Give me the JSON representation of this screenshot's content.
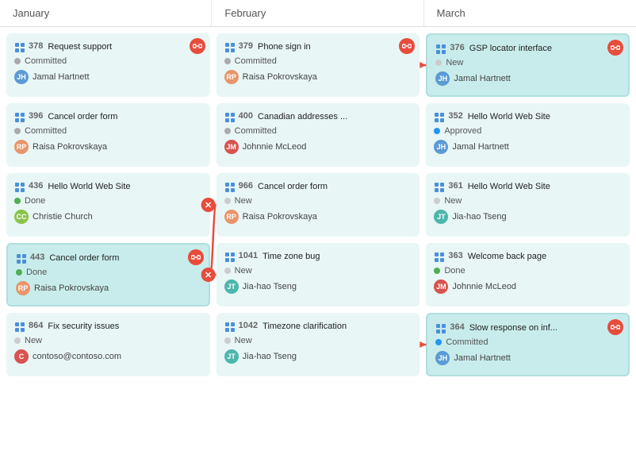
{
  "columns": [
    {
      "label": "January",
      "cards": [
        {
          "id": "378",
          "name": "Request support",
          "status": "Committed",
          "statusType": "committed",
          "user": "Jamal Hartnett",
          "avatarType": "blue",
          "avatarText": "JH",
          "hasLink": true,
          "highlighted": false
        },
        {
          "id": "396",
          "name": "Cancel order form",
          "status": "Committed",
          "statusType": "committed",
          "user": "Raisa Pokrovskaya",
          "avatarType": "orange",
          "avatarText": "RP",
          "hasLink": false,
          "highlighted": false
        },
        {
          "id": "436",
          "name": "Hello World Web Site",
          "status": "Done",
          "statusType": "done",
          "user": "Christie Church",
          "avatarType": "green",
          "avatarText": "CC",
          "hasLink": false,
          "highlighted": false
        },
        {
          "id": "443",
          "name": "Cancel order form",
          "status": "Done",
          "statusType": "done",
          "user": "Raisa Pokrovskaya",
          "avatarType": "orange",
          "avatarText": "RP",
          "hasLink": true,
          "highlighted": true
        },
        {
          "id": "864",
          "name": "Fix security issues",
          "status": "New",
          "statusType": "new",
          "user": "contoso@contoso.com",
          "avatarType": "pink",
          "avatarText": "C",
          "hasLink": false,
          "highlighted": false
        }
      ]
    },
    {
      "label": "February",
      "cards": [
        {
          "id": "379",
          "name": "Phone sign in",
          "status": "Committed",
          "statusType": "committed",
          "user": "Raisa Pokrovskaya",
          "avatarType": "orange",
          "avatarText": "RP",
          "hasLink": true,
          "highlighted": false
        },
        {
          "id": "400",
          "name": "Canadian addresses ...",
          "status": "Committed",
          "statusType": "committed",
          "user": "Johnnie McLeod",
          "avatarType": "pink",
          "avatarText": "JM",
          "hasLink": false,
          "highlighted": false
        },
        {
          "id": "966",
          "name": "Cancel order form",
          "status": "New",
          "statusType": "new",
          "user": "Raisa Pokrovskaya",
          "avatarType": "orange",
          "avatarText": "RP",
          "hasLink": false,
          "highlighted": false
        },
        {
          "id": "1041",
          "name": "Time zone bug",
          "status": "New",
          "statusType": "new",
          "user": "Jia-hao Tseng",
          "avatarType": "teal",
          "avatarText": "JT",
          "hasLink": false,
          "highlighted": false
        },
        {
          "id": "1042",
          "name": "Timezone clarification",
          "status": "New",
          "statusType": "new",
          "user": "Jia-hao Tseng",
          "avatarType": "teal",
          "avatarText": "JT",
          "hasLink": false,
          "highlighted": false
        }
      ]
    },
    {
      "label": "March",
      "cards": [
        {
          "id": "376",
          "name": "GSP locator interface",
          "status": "New",
          "statusType": "new",
          "user": "Jamal Hartnett",
          "avatarType": "blue",
          "avatarText": "JH",
          "hasLink": true,
          "highlighted": true
        },
        {
          "id": "352",
          "name": "Hello World Web Site",
          "status": "Approved",
          "statusType": "approved",
          "user": "Jamal Hartnett",
          "avatarType": "blue",
          "avatarText": "JH",
          "hasLink": false,
          "highlighted": false
        },
        {
          "id": "361",
          "name": "Hello World Web Site",
          "status": "New",
          "statusType": "new",
          "user": "Jia-hao Tseng",
          "avatarType": "teal",
          "avatarText": "JT",
          "hasLink": false,
          "highlighted": false
        },
        {
          "id": "363",
          "name": "Welcome back page",
          "status": "Done",
          "statusType": "done",
          "user": "Johnnie McLeod",
          "avatarType": "pink",
          "avatarText": "JM",
          "hasLink": false,
          "highlighted": false
        },
        {
          "id": "364",
          "name": "Slow response on inf...",
          "status": "Committed",
          "statusType": "committed-blue",
          "user": "Jamal Hartnett",
          "avatarType": "blue",
          "avatarText": "JH",
          "hasLink": true,
          "highlighted": true
        }
      ]
    }
  ]
}
